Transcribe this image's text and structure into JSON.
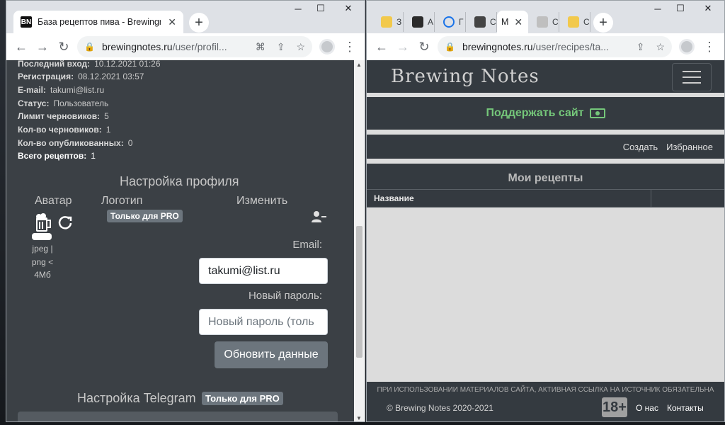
{
  "left_browser": {
    "tab": {
      "title": "База рецептов пива - Brewingnotes",
      "favicon": "BN"
    },
    "url": {
      "domain": "brewingnotes.ru",
      "path": "/user/profil..."
    }
  },
  "right_browser": {
    "mini_tabs": [
      "З",
      "А",
      "Г",
      "С",
      "М",
      "С",
      "С"
    ],
    "url": {
      "domain": "brewingnotes.ru",
      "path": "/user/recipes/ta..."
    }
  },
  "profile": {
    "rows": [
      {
        "label": "Последний вход:",
        "value": "10.12.2021 01:26"
      },
      {
        "label": "Регистрация:",
        "value": "08.12.2021 03:57"
      },
      {
        "label": "E-mail:",
        "value": "takumi@list.ru"
      },
      {
        "label": "Статус:",
        "value": "Пользователь"
      },
      {
        "label": "Лимит черновиков:",
        "value": "5"
      },
      {
        "label": "Кол-во черновиков:",
        "value": "1"
      },
      {
        "label": "Кол-во опубликованных:",
        "value": "0"
      },
      {
        "label": "Всего рецептов:",
        "value": "1"
      }
    ],
    "settings_title": "Настройка профиля",
    "avatar_label": "Аватар",
    "avatar_hint": [
      "jpeg |",
      "png <",
      "4Мб"
    ],
    "logo_label": "Логотип",
    "pro_badge": "Только для PRO",
    "edit_label": "Изменить",
    "email_label": "Email:",
    "email_value": "takumi@list.ru",
    "password_label": "Новый пароль:",
    "password_placeholder": "Новый пароль (толь",
    "update_button": "Обновить данные",
    "telegram_title": "Настройка Telegram",
    "telegram_badge": "Только для PRO"
  },
  "site": {
    "logo": "Brewing Notes",
    "support": "Поддержать сайт",
    "create": "Создать",
    "favorites": "Избранное",
    "my_recipes": "Мои рецепты",
    "col_name": "Название",
    "footer_note": "ПРИ ИСПОЛЬЗОВАНИИ МАТЕРИАЛОВ САЙТА, АКТИВНАЯ ССЫЛКА НА ИСТОЧНИК ОБЯЗАТЕЛЬНА",
    "copyright": "© Brewing Notes 2020-2021",
    "age": "18+",
    "about": "О нас",
    "contacts": "Контакты"
  }
}
